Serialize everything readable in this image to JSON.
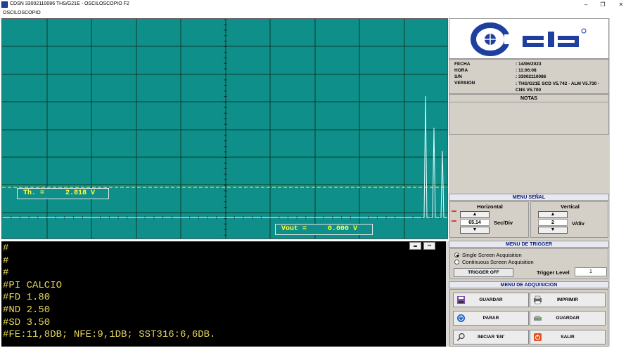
{
  "window": {
    "title": "CDSN 33002110086 THS/G21E - OSCILOSCOPIO F2",
    "minimize": "–",
    "restore": "❐",
    "close": "✕"
  },
  "menu": {
    "label": "OSCILOSCOPIO"
  },
  "scope": {
    "threshold_label": "Th. =",
    "threshold_value": "2.818 V",
    "vout_label": "Vout =",
    "vout_value": "0.000 V",
    "colors": {
      "background": "#0e8f8a",
      "grid": "#0a3c2e",
      "trace": "#e0ffff",
      "threshold": "#f2e600"
    }
  },
  "console": {
    "lines": [
      "#",
      "#",
      "#",
      "#PI CALCIO",
      "#FD 1.80",
      "#ND 2.50",
      "#SD 3.50",
      "#FE:11,8DB; NFE:9,1DB; SST316:6,6DB."
    ],
    "minimize": "▬",
    "restore": "▭"
  },
  "info": {
    "rows": [
      {
        "key": "FECHA",
        "value": ": 14/06/2023"
      },
      {
        "key": "HORA",
        "value": ": 11:06:08"
      },
      {
        "key": "S/N",
        "value": ": 33002110086"
      },
      {
        "key": "VERSION",
        "value": ": THS/G21E SCD V5.742 - ALM V5.730 - CNS V5.700"
      }
    ],
    "notes_title": "NOTAS"
  },
  "menu_senal": {
    "title": "MENU SEÑAL",
    "horizontal": {
      "label": "Horizontal",
      "value": "65.14",
      "unit": "Sec/Div"
    },
    "vertical": {
      "label": "Vertical",
      "value": "2",
      "unit": "V/div"
    },
    "up": "▲",
    "down": "▼"
  },
  "menu_trigger": {
    "title": "MENU DE TRIGGER",
    "options": [
      "Single Screen Acquisition",
      "Continuous Screen Acquisition"
    ],
    "selected": "Single Screen Acquisition",
    "trigger_off": "TRIGGER OFF",
    "level_label": "Trigger Level",
    "level_value": "1"
  },
  "menu_adquisicion": {
    "title": "MENU DE ADQUISICION",
    "buttons": {
      "guardar1": "GUARDAR",
      "imprimir": "IMPRIMIR",
      "parar": "PARAR",
      "guardar2": "GUARDAR",
      "iniciar": "INICIAR 'EN'",
      "salir": "SALIR"
    }
  }
}
